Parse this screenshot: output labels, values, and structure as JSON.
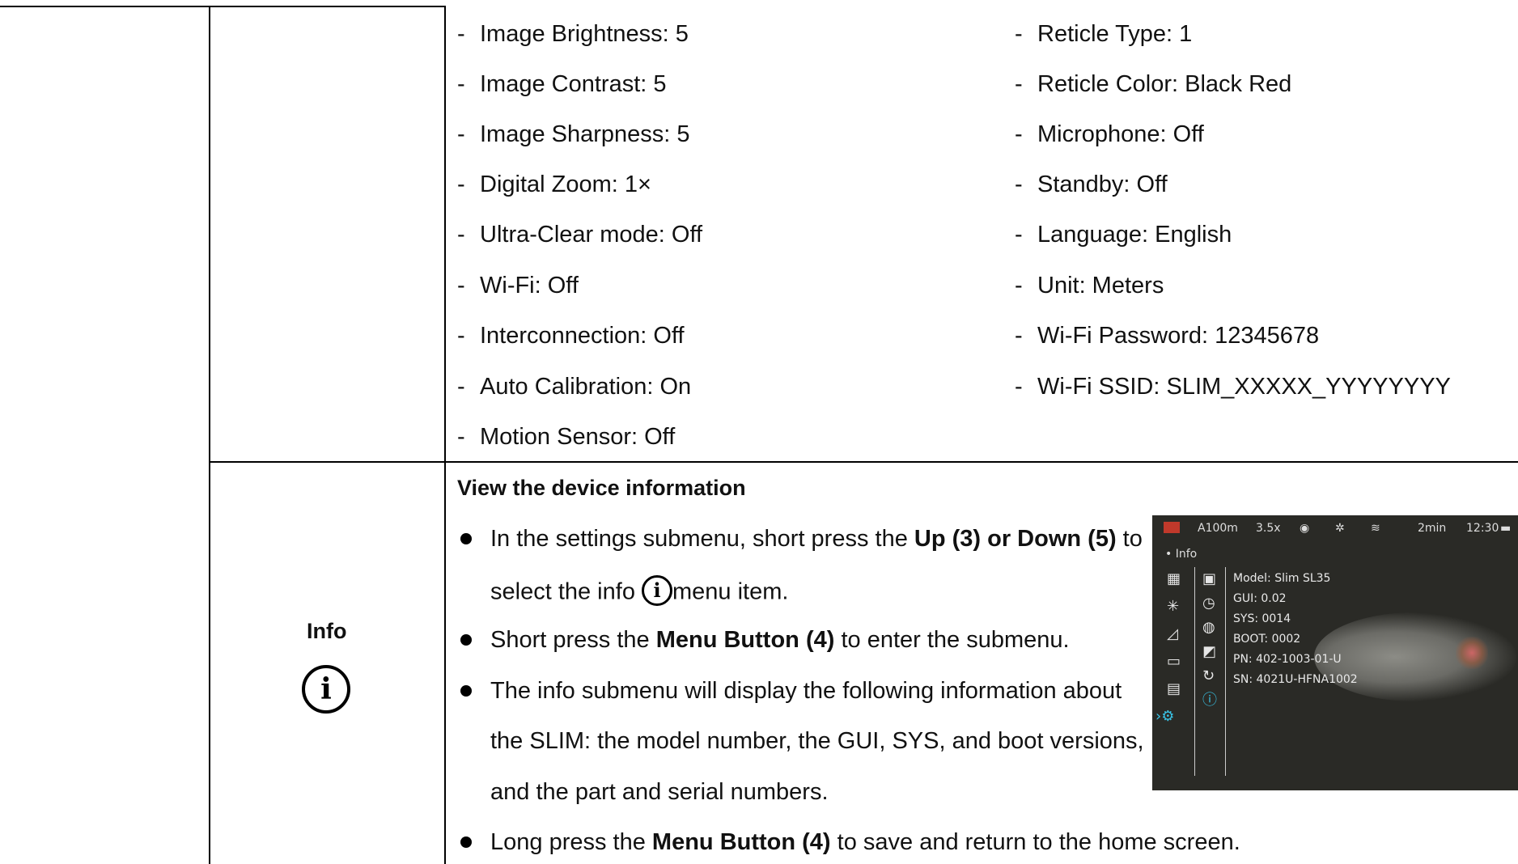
{
  "settings_left": [
    "Image Brightness: 5",
    "Image Contrast: 5",
    "Image Sharpness: 5",
    "Digital Zoom: 1×",
    "Ultra-Clear mode: Off",
    "Wi-Fi: Off",
    "Interconnection: Off",
    "Auto Calibration: On",
    "Motion Sensor: Off"
  ],
  "settings_right": [
    "Reticle Type: 1",
    "Reticle Color: Black Red",
    "Microphone: Off",
    "Standby: Off",
    "Language: English",
    "Unit: Meters",
    "Wi-Fi Password: 12345678",
    "Wi-Fi SSID: SLIM_XXXXX_YYYYYYYY"
  ],
  "info_row": {
    "label": "Info",
    "icon": "info-circle-icon",
    "heading": "View the device information",
    "b1_pre": "In the settings submenu, short press the ",
    "b1_bold": "Up (3) or Down (5)",
    "b1_post": " to",
    "b1_line2_pre": "select the info ",
    "b1_line2_post": "menu item.",
    "b2_pre": "Short press the ",
    "b2_bold": "Menu Button (4)",
    "b2_post": " to enter the submenu.",
    "b3_line1": "The info submenu will display the following information about",
    "b3_line2": "the SLIM: the model number, the GUI, SYS, and boot versions,",
    "b3_line3": "and the part and serial numbers.",
    "b4_pre": "Long press the ",
    "b4_bold": "Menu Button (4)",
    "b4_post": " to save and return to the home screen."
  },
  "device_screen": {
    "status": {
      "range": "A100m",
      "zoom": "3.5x",
      "battery_time": "2min",
      "clock": "12:30"
    },
    "breadcrumb": "• Info",
    "info_lines": [
      "Model:  Slim SL35",
      "GUI:  0.02",
      "SYS:  0014",
      "BOOT:  0002",
      "PN:  402-1003-01-U",
      "SN:  4021U-HFNA1002"
    ],
    "accent": "#39c3e6"
  }
}
